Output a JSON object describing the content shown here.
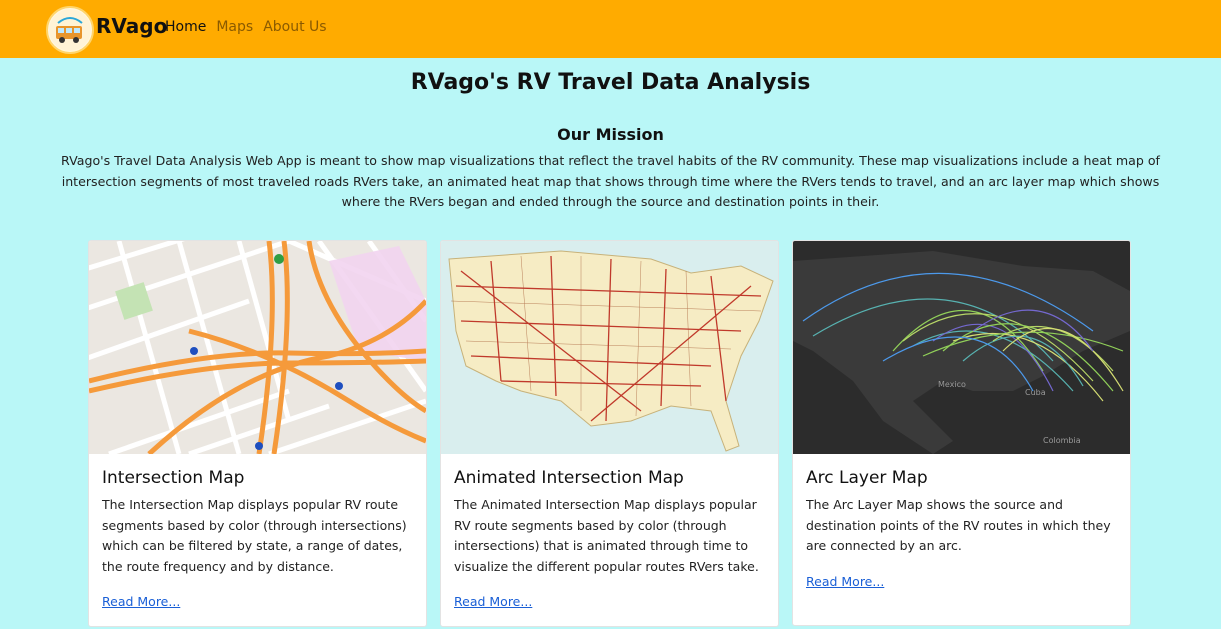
{
  "nav": {
    "brand": "RVago",
    "links": [
      {
        "label": "Home",
        "active": true
      },
      {
        "label": "Maps",
        "active": false
      },
      {
        "label": "About Us",
        "active": false
      }
    ]
  },
  "page": {
    "title": "RVago's RV Travel Data Analysis",
    "mission_heading": "Our Mission",
    "mission_text": "RVago's Travel Data Analysis Web App is meant to show map visualizations that reflect the travel habits of the RV community. These map visualizations include a heat map of intersection segments of most traveled roads RVers take, an animated heat map that shows through time where the RVers tends to travel, and an arc layer map which shows where the RVers began and ended through the source and destination points in their."
  },
  "cards": [
    {
      "title": "Intersection Map",
      "text": "The Intersection Map displays popular RV route segments based by color (through intersections) which can be filtered by state, a range of dates, the route frequency and by distance.",
      "link": "Read More..."
    },
    {
      "title": "Animated Intersection Map",
      "text": "The Animated Intersection Map displays popular RV route segments based by color (through intersections) that is animated through time to visualize the different popular routes RVers take.",
      "link": "Read More..."
    },
    {
      "title": "Arc Layer Map",
      "text": "The Arc Layer Map shows the source and destination points of the RV routes in which they are connected by an arc.",
      "link": "Read More...",
      "map_labels": [
        "Mexico",
        "Cuba",
        "Colombia"
      ]
    }
  ],
  "colors": {
    "navbar": "#ffab00",
    "background": "#b9f7f7",
    "link": "#1a5fd6"
  }
}
